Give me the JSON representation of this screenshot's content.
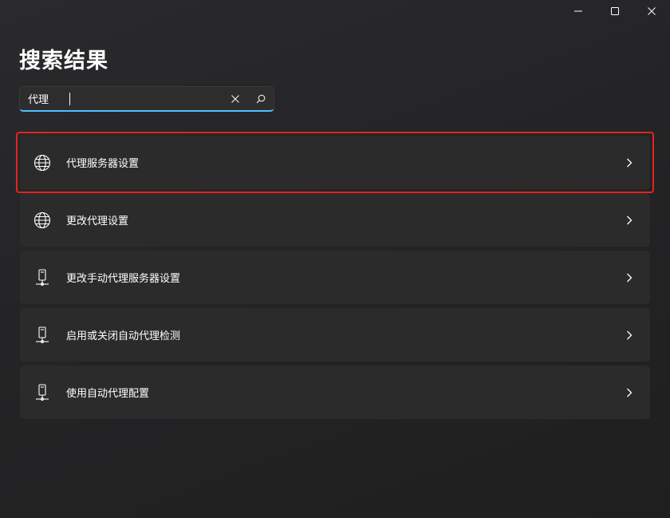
{
  "page": {
    "title": "搜索结果"
  },
  "search": {
    "value": "代理"
  },
  "results": [
    {
      "label": "代理服务器设置",
      "icon": "globe-icon",
      "highlighted": true
    },
    {
      "label": "更改代理设置",
      "icon": "globe-icon",
      "highlighted": false
    },
    {
      "label": "更改手动代理服务器设置",
      "icon": "network-computer-icon",
      "highlighted": false
    },
    {
      "label": "启用或关闭自动代理检测",
      "icon": "network-computer-icon",
      "highlighted": false
    },
    {
      "label": "使用自动代理配置",
      "icon": "network-computer-icon",
      "highlighted": false
    }
  ],
  "colors": {
    "accent": "#4cc2ff",
    "highlight_border": "#e3231f",
    "card_bg": "#2b2b2b"
  }
}
